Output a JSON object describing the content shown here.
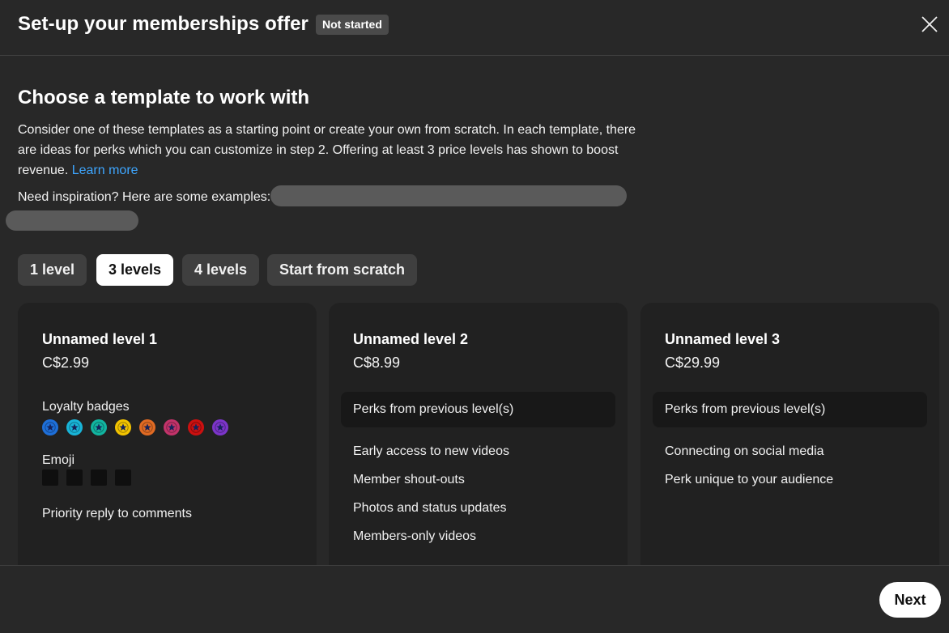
{
  "header": {
    "title": "Set-up your memberships offer",
    "status": "Not started",
    "close_icon": "close-icon"
  },
  "intro": {
    "heading": "Choose a template to work with",
    "description": "Consider one of these templates as a starting point or create your own from scratch. In each template, there are ideas for perks which you can customize in step 2. Offering at least 3 price levels has shown to boost revenue.",
    "learn_more": "Learn more",
    "inspiration": "Need inspiration? Here are some examples:"
  },
  "tabs": [
    {
      "label": "1 level",
      "active": false
    },
    {
      "label": "3 levels",
      "active": true
    },
    {
      "label": "4 levels",
      "active": false
    },
    {
      "label": "Start from scratch",
      "active": false
    }
  ],
  "levels": [
    {
      "name": "Unnamed level 1",
      "price": "C$2.99",
      "loyalty_label": "Loyalty badges",
      "badge_colors": [
        "#1e6fd9",
        "#18b4d8",
        "#12b4a0",
        "#f2c300",
        "#e06a23",
        "#c2336a",
        "#cc1010",
        "#7b35c9"
      ],
      "emoji_label": "Emoji",
      "perks": [
        "Priority reply to comments"
      ]
    },
    {
      "name": "Unnamed level 2",
      "price": "C$8.99",
      "previous": "Perks from previous level(s)",
      "perks": [
        "Early access to new videos",
        "Member shout-outs",
        "Photos and status updates",
        "Members-only videos"
      ]
    },
    {
      "name": "Unnamed level 3",
      "price": "C$29.99",
      "previous": "Perks from previous level(s)",
      "perks": [
        "Connecting on social media",
        "Perk unique to your audience"
      ]
    }
  ],
  "footer": {
    "next_label": "Next"
  }
}
